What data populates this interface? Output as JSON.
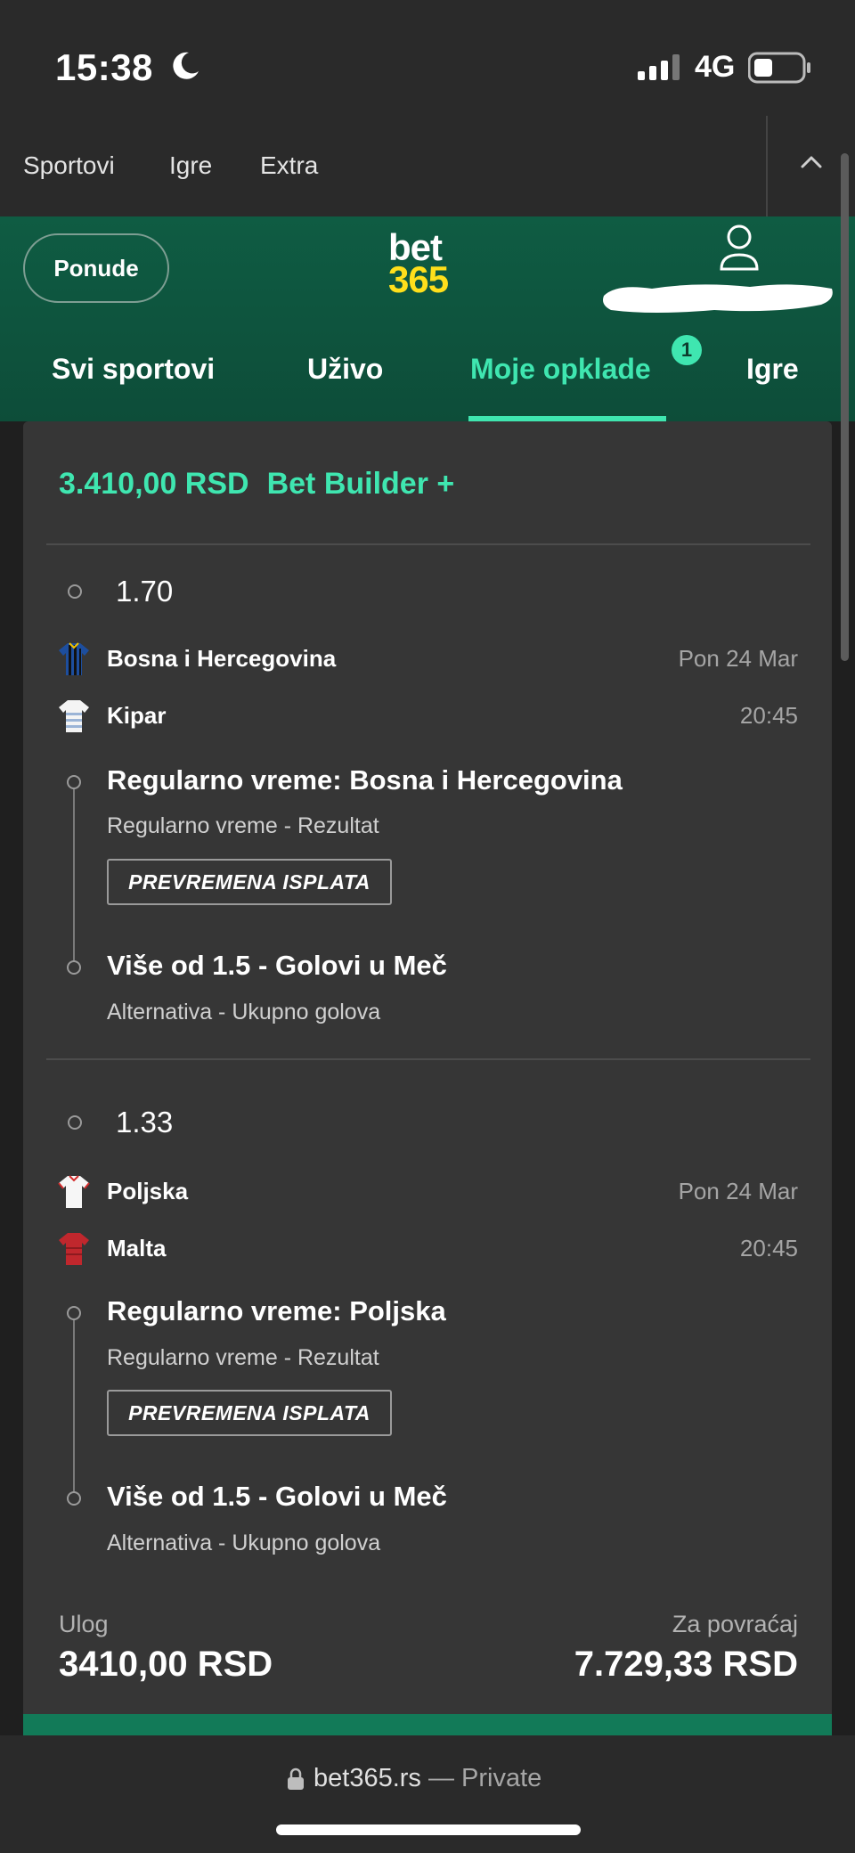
{
  "status_bar": {
    "time": "15:38",
    "network": "4G"
  },
  "top_menu": {
    "items": [
      "Sportovi",
      "Igre",
      "Extra"
    ]
  },
  "header": {
    "offers_label": "Ponude",
    "logo_top": "bet",
    "logo_bottom": "365",
    "nav": [
      {
        "label": "Svi sportovi"
      },
      {
        "label": "Uživo"
      },
      {
        "label": "Moje opklade",
        "active": true
      },
      {
        "label": "Igre"
      }
    ],
    "badge_count": "1"
  },
  "bet": {
    "stake_amount": "3.410,00 RSD",
    "bet_type": "Bet Builder +",
    "legs": [
      {
        "odds": "1.70",
        "home_team": "Bosna i Hercegovina",
        "away_team": "Kipar",
        "date": "Pon 24 Mar",
        "time": "20:45",
        "selections": [
          {
            "title": "Regularno vreme: Bosna i Hercegovina",
            "market": "Regularno vreme - Rezultat",
            "tag": "PREVREMENA ISPLATA"
          },
          {
            "title": "Više od 1.5 - Golovi u Meč",
            "market": "Alternativa - Ukupno golova"
          }
        ]
      },
      {
        "odds": "1.33",
        "home_team": "Poljska",
        "away_team": "Malta",
        "date": "Pon 24 Mar",
        "time": "20:45",
        "selections": [
          {
            "title": "Regularno vreme: Poljska",
            "market": "Regularno vreme - Rezultat",
            "tag": "PREVREMENA ISPLATA"
          },
          {
            "title": "Više od 1.5 - Golovi u Meč",
            "market": "Alternativa - Ukupno golova"
          }
        ]
      }
    ],
    "stake_label": "Ulog",
    "stake_value": "3410,00 RSD",
    "return_label": "Za povraćaj",
    "return_value": "7.729,33 RSD"
  },
  "browser": {
    "domain": "bet365.rs",
    "mode": " — Private"
  },
  "colors": {
    "accent": "#3fe6b0",
    "brand_green": "#0f5c43",
    "logo_yellow": "#ffdf1b",
    "card_bg": "#363636"
  }
}
